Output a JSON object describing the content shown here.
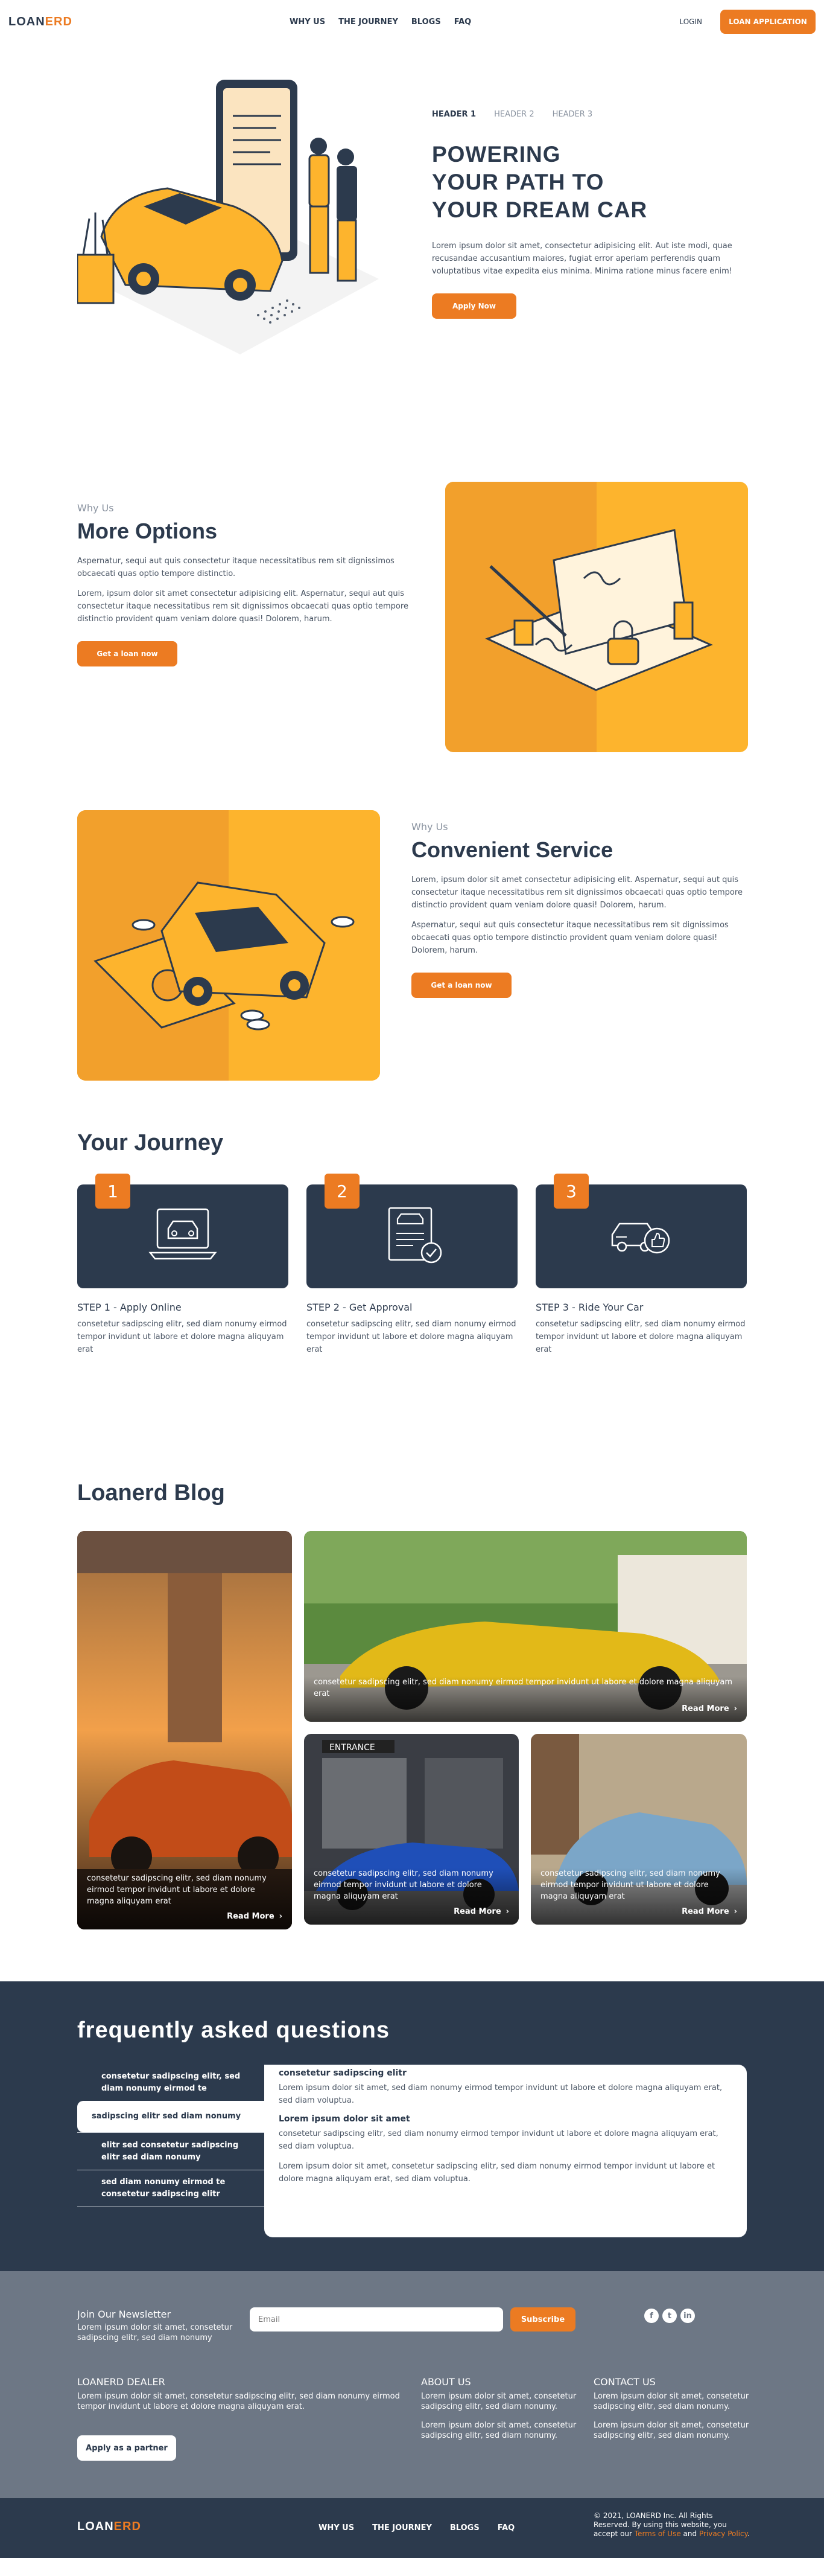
{
  "brand": {
    "logo_left": "LOAN",
    "logo_right": "ERD",
    "accent_color": "#ec7b22",
    "navy_color": "#2c3a4d"
  },
  "nav": {
    "links": [
      "WHY US",
      "THE JOURNEY",
      "BLOGS",
      "FAQ"
    ],
    "login": "LOGIN",
    "cta": "LOAN APPLICATION"
  },
  "hero": {
    "tabs": [
      "HEADER 1",
      "HEADER 2",
      "HEADER 3"
    ],
    "title": "POWERING\nYOUR PATH TO\nYOUR DREAM CAR",
    "description": "Lorem ipsum dolor sit amet, consectetur adipisicing elit. Aut iste modi, quae recusandae accusantium maiores, fugiat error aperiam perferendis quam voluptatibus vitae expedita eius minima. Minima ratione minus facere enim!",
    "button": "Apply Now"
  },
  "options": {
    "eyebrow": "Why Us",
    "title": "More Options",
    "p1": "Aspernatur, sequi aut quis consectetur itaque necessitatibus rem sit dignissimos obcaecati quas optio tempore distinctio.",
    "p2": "Lorem, ipsum dolor sit amet consectetur adipisicing elit. Aspernatur, sequi aut quis consectetur itaque necessitatibus rem sit dignissimos obcaecati quas optio tempore distinctio provident quam veniam dolore quasi! Dolorem, harum.",
    "button": "Get a loan now"
  },
  "service": {
    "eyebrow": "Why Us",
    "title": "Convenient Service",
    "p1": "Lorem, ipsum dolor sit amet consectetur adipisicing elit. Aspernatur, sequi aut quis consectetur itaque necessitatibus rem sit dignissimos obcaecati quas optio tempore distinctio provident quam veniam dolore quasi! Dolorem, harum.",
    "p2": "Aspernatur, sequi aut quis consectetur itaque necessitatibus rem sit dignissimos obcaecati quas optio tempore distinctio provident quam veniam dolore quasi! Dolorem, harum.",
    "button": "Get a loan now"
  },
  "journey": {
    "title": "Your Journey",
    "steps": [
      {
        "num": "1",
        "title": "STEP 1 - Apply Online",
        "desc": "consetetur sadipscing elitr, sed diam nonumy eirmod tempor invidunt ut labore et dolore magna aliquyam erat",
        "icon": "laptop-car-icon"
      },
      {
        "num": "2",
        "title": "STEP 2 - Get Approval",
        "desc": "consetetur sadipscing elitr, sed diam nonumy eirmod tempor invidunt ut labore et dolore magna aliquyam erat",
        "icon": "approved-document-icon"
      },
      {
        "num": "3",
        "title": "STEP 3 - Ride Your Car",
        "desc": "consetetur sadipscing elitr, sed diam nonumy eirmod tempor invidunt ut labore et dolore magna aliquyam erat",
        "icon": "car-thumbs-up-icon"
      }
    ]
  },
  "blog": {
    "title": "Loanerd Blog",
    "posts": [
      {
        "text": "consetetur sadipscing elitr, sed diam nonumy eirmod tempor invidunt ut labore et dolore magna aliquyam erat",
        "read_more": "Read More"
      },
      {
        "text": "consetetur sadipscing elitr, sed diam nonumy eirmod tempor invidunt ut labore et dolore magna aliquyam erat",
        "read_more": "Read More"
      },
      {
        "text": "consetetur sadipscing elitr, sed diam nonumy eirmod tempor invidunt ut labore et dolore magna aliquyam erat",
        "read_more": "Read More",
        "sign": "ENTRANCE"
      },
      {
        "text": "consetetur sadipscing elitr, sed diam nonumy eirmod tempor invidunt ut labore et dolore magna aliquyam erat",
        "read_more": "Read More"
      }
    ]
  },
  "faq": {
    "title": "frequently asked questions",
    "items": [
      "consetetur sadipscing elitr, sed diam nonumy eirmod te",
      "sadipscing elitr sed diam nonumy",
      "elitr sed consetetur sadipscing elitr sed diam nonumy",
      "sed diam nonumy eirmod te consetetur sadipscing elitr"
    ],
    "panel": {
      "h1": "consetetur sadipscing elitr",
      "p1": "Lorem ipsum dolor sit amet, sed diam nonumy eirmod tempor invidunt ut labore et dolore magna aliquyam erat, sed diam voluptua.",
      "h2": "Lorem ipsum dolor sit amet",
      "p2": "consetetur sadipscing elitr, sed diam nonumy eirmod tempor invidunt ut labore et dolore magna aliquyam erat, sed diam voluptua.",
      "p3": "Lorem ipsum dolor sit amet, consetetur sadipscing elitr, sed diam nonumy eirmod tempor invidunt ut labore et dolore magna aliquyam erat, sed diam voluptua."
    }
  },
  "newsletter": {
    "title": "Join Our Newsletter",
    "desc": "Lorem ipsum dolor sit amet, consetetur sadipscing elitr, sed diam nonumy",
    "placeholder": "Email",
    "button": "Subscribe",
    "social": [
      "facebook-icon",
      "twitter-icon",
      "linkedin-icon"
    ]
  },
  "footer": {
    "dealer_title": "LOANERD DEALER",
    "dealer_desc": "Lorem ipsum dolor sit amet, consetetur sadipscing elitr, sed diam nonumy eirmod tempor invidunt ut labore et dolore magna aliquyam erat.",
    "partner_button": "Apply as a partner",
    "about_title": "ABOUT US",
    "about_p1": "Lorem ipsum dolor sit amet, consetetur sadipscing elitr, sed diam nonumy.",
    "about_p2": "Lorem ipsum dolor sit amet, consetetur sadipscing elitr, sed diam nonumy.",
    "contact_title": "CONTACT US",
    "contact_p1": "Lorem ipsum dolor sit amet, consetetur sadipscing elitr, sed diam nonumy.",
    "contact_p2": "Lorem ipsum dolor sit amet, consetetur sadipscing elitr, sed diam nonumy.",
    "links": [
      "WHY US",
      "THE JOURNEY",
      "BLOGS",
      "FAQ"
    ],
    "copyright_a": "© 2021, LOANERD Inc. All Rights Reserved. By using this website, you accept our ",
    "terms": "Terms of Use",
    "and": " and ",
    "privacy": "Privacy Policy",
    "dot": "."
  }
}
